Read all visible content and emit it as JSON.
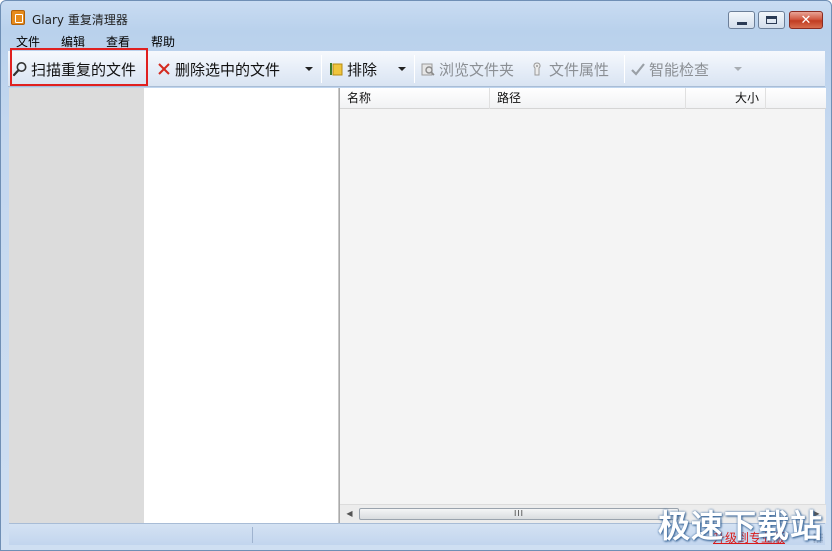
{
  "window": {
    "title": "Glary 重复清理器",
    "app_icon": "app-logo-icon",
    "controls": {
      "minimize": "minimize-icon",
      "maximize": "maximize-icon",
      "close": "close-icon",
      "close_glyph": "✕"
    }
  },
  "menu": [
    "文件",
    "编辑",
    "查看",
    "帮助"
  ],
  "toolbar": {
    "scan": {
      "label": "扫描重复的文件",
      "icon": "magnifier-icon"
    },
    "delete": {
      "label": "删除选中的文件",
      "icon": "red-x-icon"
    },
    "exclude": {
      "label": "排除",
      "icon": "exclude-icon"
    },
    "browse": {
      "label": "浏览文件夹",
      "icon": "browse-folder-icon",
      "enabled": false
    },
    "properties": {
      "label": "文件属性",
      "icon": "file-properties-icon",
      "enabled": false
    },
    "smart_check": {
      "label": "智能检查",
      "icon": "checkmark-icon",
      "enabled": false
    }
  },
  "list": {
    "columns": [
      "名称",
      "路径",
      "大小"
    ],
    "rows": [],
    "scroll_thumb_glyph": "III"
  },
  "status": {
    "upgrade_link": "升级到专业版"
  },
  "watermark": "极速下载站",
  "colors": {
    "highlight_border": "#e02020",
    "upgrade_link": "#d81b1b",
    "close_button": "#c13c22"
  }
}
